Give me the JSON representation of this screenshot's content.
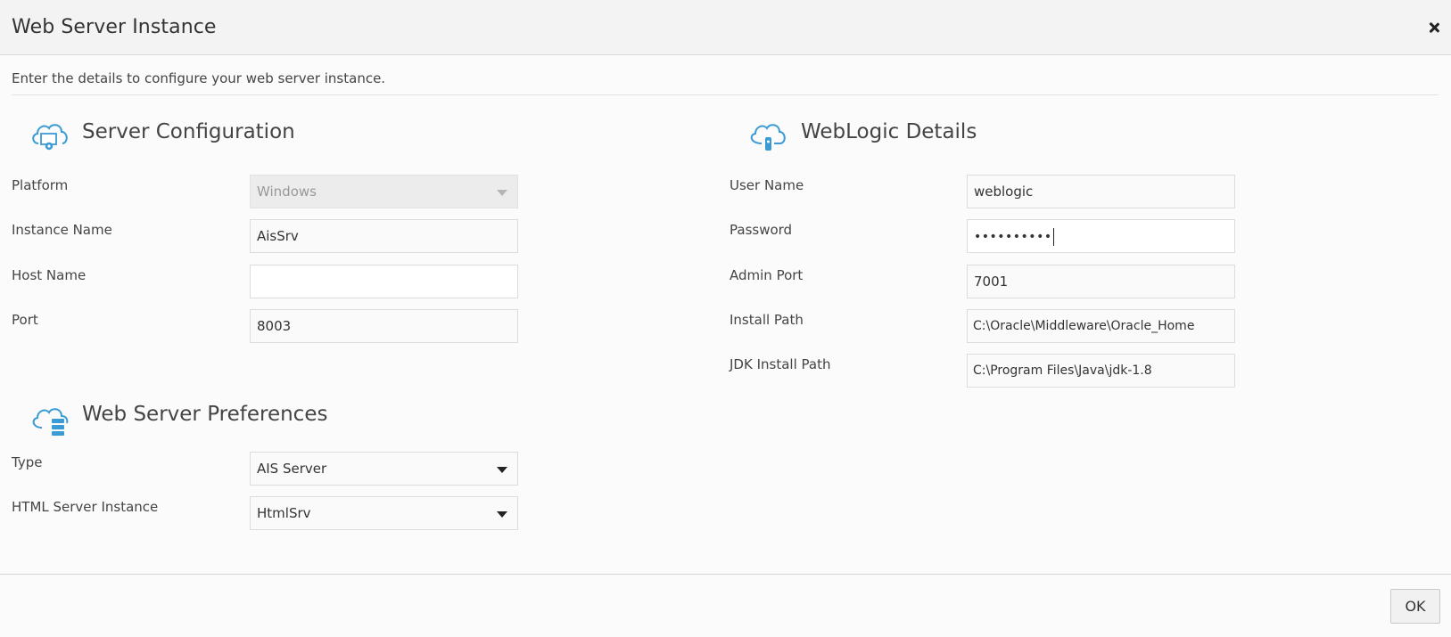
{
  "dialog": {
    "title": "Web Server Instance",
    "close_icon": "close-icon",
    "intro": "Enter the details to configure your web server instance."
  },
  "server_configuration": {
    "title": "Server Configuration",
    "icon": "cloud-settings-icon",
    "platform": {
      "label": "Platform",
      "value": "Windows",
      "disabled": true
    },
    "instance_name": {
      "label": "Instance Name",
      "value": "AisSrv"
    },
    "host_name": {
      "label": "Host Name",
      "value": ""
    },
    "port": {
      "label": "Port",
      "value": "8003"
    }
  },
  "web_server_preferences": {
    "title": "Web Server Preferences",
    "icon": "cloud-server-icon",
    "type": {
      "label": "Type",
      "value": "AIS Server"
    },
    "html_server_instance": {
      "label": "HTML Server Instance",
      "value": "HtmlSrv"
    }
  },
  "weblogic_details": {
    "title": "WebLogic Details",
    "icon": "cloud-lock-icon",
    "user_name": {
      "label": "User Name",
      "value": "weblogic"
    },
    "password": {
      "label": "Password",
      "value": "••••••••••"
    },
    "admin_port": {
      "label": "Admin Port",
      "value": "7001"
    },
    "install_path": {
      "label": "Install Path",
      "value": "C:\\Oracle\\Middleware\\Oracle_Home"
    },
    "jdk_install_path": {
      "label": "JDK Install Path",
      "value": "C:\\Program Files\\Java\\jdk-1.8"
    }
  },
  "footer": {
    "ok_label": "OK"
  },
  "colors": {
    "icon_blue": "#3a9bd5",
    "header_bg": "#f3f3f3",
    "disabled_bg": "#ececec"
  }
}
